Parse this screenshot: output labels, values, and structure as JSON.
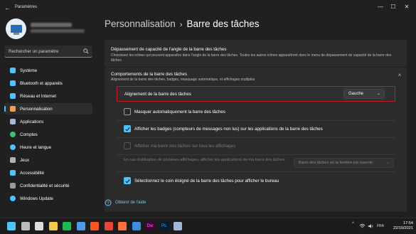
{
  "window": {
    "title": "Paramètres",
    "controls": {
      "minimize": "—",
      "maximize": "☐",
      "close": "✕"
    }
  },
  "search": {
    "placeholder": "Rechercher un paramètre"
  },
  "sidebar": {
    "items": [
      {
        "label": "Système",
        "icon": "monitor-icon",
        "color": "#4cc2ff",
        "active": false
      },
      {
        "label": "Bluetooth et appareils",
        "icon": "bluetooth-icon",
        "color": "#4cc2ff",
        "active": false
      },
      {
        "label": "Réseau et Internet",
        "icon": "wifi-icon",
        "color": "#4cc2ff",
        "active": false
      },
      {
        "label": "Personnalisation",
        "icon": "brush-icon",
        "color": "#e8a05c",
        "active": true
      },
      {
        "label": "Applications",
        "icon": "apps-icon",
        "color": "#9fb8d8",
        "active": false
      },
      {
        "label": "Comptes",
        "icon": "person-icon",
        "color": "#3fbf6f",
        "active": false
      },
      {
        "label": "Heure et langue",
        "icon": "globe-clock-icon",
        "color": "#4cc2ff",
        "active": false
      },
      {
        "label": "Jeux",
        "icon": "gamepad-icon",
        "color": "#b0b0b0",
        "active": false
      },
      {
        "label": "Accessibilité",
        "icon": "accessibility-icon",
        "color": "#4cc2ff",
        "active": false
      },
      {
        "label": "Confidentialité et sécurité",
        "icon": "shield-icon",
        "color": "#9a9a9a",
        "active": false
      },
      {
        "label": "Windows Update",
        "icon": "update-icon",
        "color": "#4cc2ff",
        "active": false
      }
    ]
  },
  "breadcrumb": {
    "parent": "Personnalisation",
    "separator": "›",
    "current": "Barre des tâches"
  },
  "overflow_card": {
    "title": "Dépassement de capacité de l'angle de la barre des tâches",
    "description": "Choisissez les icônes qui peuvent apparaître dans l'angle de la barre des tâches. Toutes les autres icônes apparaîtront dans le menu de dépassement de capacité de la barre des tâches"
  },
  "behaviors_card": {
    "title": "Comportements de la barre des tâches",
    "description": "Alignement de la barre des tâches, badges, masquage automatique, et affichages multiples",
    "alignment": {
      "label": "Alignement de la barre des tâches",
      "value": "Gauche"
    },
    "options": [
      {
        "label": "Masquer automatiquement la barre des tâches",
        "checked": false,
        "disabled": false
      },
      {
        "label": "Afficher les badges (compteurs de messages non lus) sur les applications de la barre des tâches",
        "checked": true,
        "disabled": false
      },
      {
        "label": "Afficher ma barre des tâches sur tous les affichages",
        "checked": false,
        "disabled": true
      }
    ],
    "multi_display": {
      "label": "En cas d'utilisation de plusieurs affichages, afficher les applications de ma barre des tâches",
      "value": "Barre des tâches où la fenêtre est ouverte"
    },
    "far_corner": {
      "label": "Sélectionnez le coin éloigné de la barre des tâches pour afficher le bureau",
      "checked": true
    }
  },
  "help": {
    "label": "Obtenir de l'aide"
  },
  "taskbar": {
    "apps": [
      {
        "icon": "windows-start-icon",
        "color": "#4cc2ff"
      },
      {
        "icon": "search-taskbar-icon",
        "color": "#bbbbbb"
      },
      {
        "icon": "task-view-icon",
        "color": "#dddddd"
      },
      {
        "icon": "file-explorer-icon",
        "color": "#f2c94c"
      },
      {
        "icon": "spotify-icon",
        "color": "#1db954"
      },
      {
        "icon": "store-icon",
        "color": "#4c9be8"
      },
      {
        "icon": "brave-icon",
        "color": "#fb542b"
      },
      {
        "icon": "chrome-icon",
        "color": "#e7453b"
      },
      {
        "icon": "firefox-icon",
        "color": "#ff7139"
      },
      {
        "icon": "mail-icon",
        "color": "#3d8ee0"
      },
      {
        "icon": "dreamweaver-icon",
        "color": "#470137",
        "text": "Dw"
      },
      {
        "icon": "photoshop-icon",
        "color": "#001e36",
        "text": "Ps"
      },
      {
        "icon": "settings-taskbar-icon",
        "color": "#9fb8d8"
      }
    ],
    "tray": {
      "chevron": "^",
      "lang": "FRA"
    },
    "time": "17:54",
    "date": "22/10/2021"
  }
}
